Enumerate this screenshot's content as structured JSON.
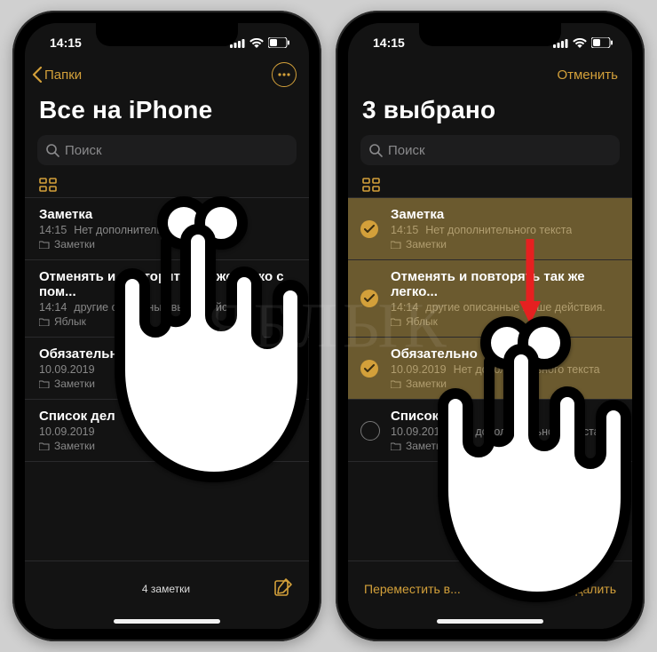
{
  "status": {
    "time": "14:15"
  },
  "left": {
    "back_label": "Папки",
    "title": "Все на iPhone",
    "search_placeholder": "Поиск",
    "notes": [
      {
        "title": "Заметка",
        "date": "14:15",
        "snippet": "Нет дополнительного текста",
        "folder": "Заметки"
      },
      {
        "title": "Отменять и повторять так же легко с пом...",
        "date": "14:14",
        "snippet": "другие описанные выше действия.",
        "folder": "Яблык"
      },
      {
        "title": "Обязательно",
        "date": "10.09.2019",
        "snippet": "",
        "folder": "Заметки"
      },
      {
        "title": "Список дел",
        "date": "10.09.2019",
        "snippet": "",
        "folder": "Заметки"
      }
    ],
    "footer_count": "4 заметки"
  },
  "right": {
    "cancel_label": "Отменить",
    "title": "3 выбрано",
    "search_placeholder": "Поиск",
    "notes": [
      {
        "title": "Заметка",
        "date": "14:15",
        "snippet": "Нет дополнительного текста",
        "folder": "Заметки",
        "selected": true
      },
      {
        "title": "Отменять и повторять так же легко...",
        "date": "14:14",
        "snippet": "другие описанные выше действия.",
        "folder": "Яблык",
        "selected": true
      },
      {
        "title": "Обязательно",
        "date": "10.09.2019",
        "snippet": "Нет дополнительного текста",
        "folder": "Заметки",
        "selected": true
      },
      {
        "title": "Список дел",
        "date": "10.09.2019",
        "snippet": "Нет дополнительного текста",
        "folder": "Заметки",
        "selected": false
      }
    ],
    "move_label": "Переместить в...",
    "delete_label": "Удалить"
  },
  "watermark": "ЯБЛЫК"
}
